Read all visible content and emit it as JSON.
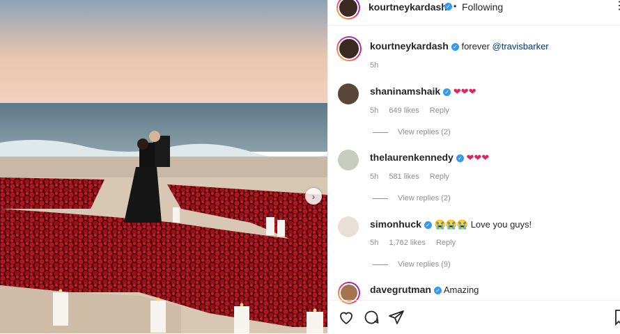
{
  "header": {
    "username": "kourtneykardash",
    "separator": "•",
    "follow_status": "Following"
  },
  "caption": {
    "username": "kourtneykardash",
    "text": "forever ",
    "mention": "@travisbarker",
    "time": "5h"
  },
  "comments": [
    {
      "username": "shaninamshaik",
      "text": "❤❤❤",
      "time": "5h",
      "likes": "649 likes",
      "reply": "Reply",
      "view_replies": "View replies (2)"
    },
    {
      "username": "thelaurenkennedy",
      "text": "❤❤❤",
      "time": "5h",
      "likes": "581 likes",
      "reply": "Reply",
      "view_replies": "View replies (2)"
    },
    {
      "username": "simonhuck",
      "text": "😭😭😭 Love you guys!",
      "time": "5h",
      "likes": "1,762 likes",
      "reply": "Reply",
      "view_replies": "View replies (9)"
    },
    {
      "username": "davegrutman",
      "text": "Amazing"
    }
  ],
  "icons": {
    "like": "heart-icon",
    "comment": "comment-icon",
    "share": "share-icon",
    "save": "bookmark-icon",
    "next": "chevron-right-icon"
  }
}
